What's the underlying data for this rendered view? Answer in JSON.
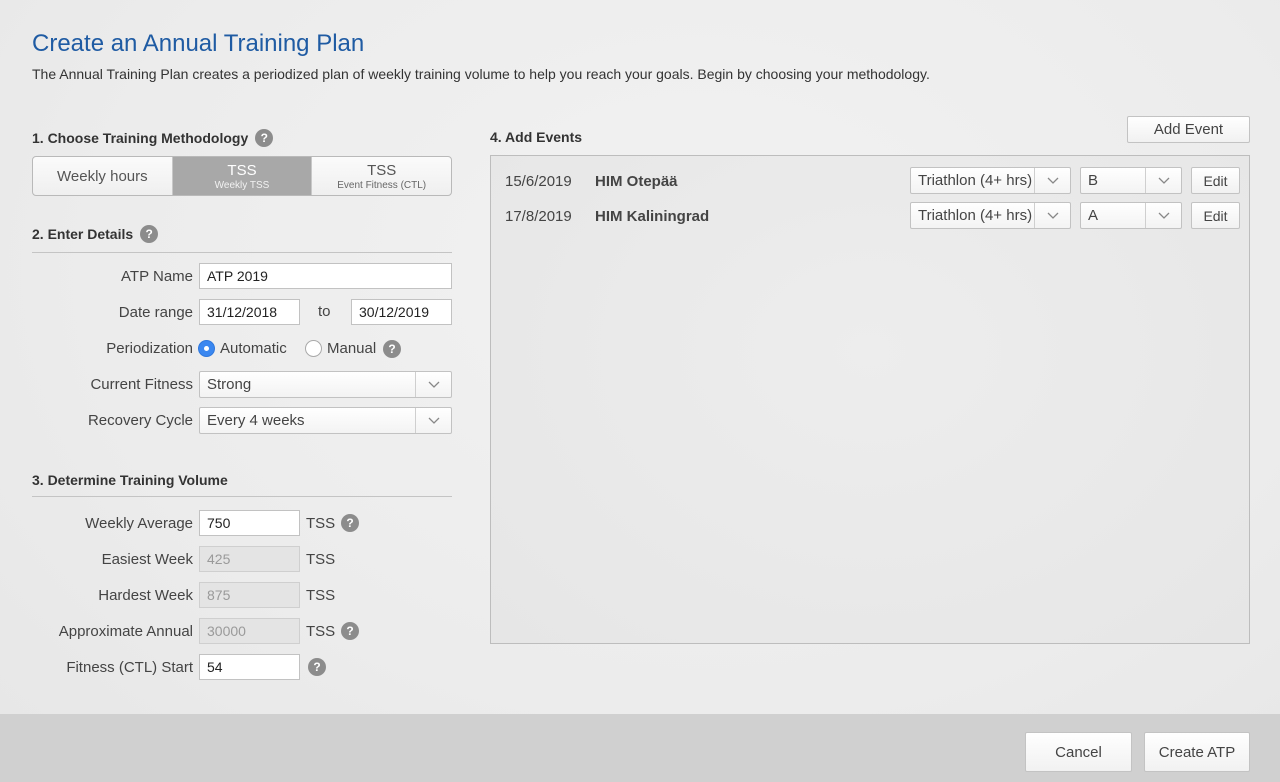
{
  "header": {
    "title": "Create an Annual Training Plan",
    "subtitle": "The Annual Training Plan creates a periodized plan of weekly training volume to help you reach your goals. Begin by choosing your methodology."
  },
  "methodology": {
    "title": "1. Choose Training Methodology",
    "help": "?",
    "options": [
      {
        "label": "Weekly hours",
        "sub": ""
      },
      {
        "label": "TSS",
        "sub": "Weekly TSS",
        "selected": true
      },
      {
        "label": "TSS",
        "sub": "Event Fitness (CTL)"
      }
    ]
  },
  "details": {
    "title": "2. Enter Details",
    "help": "?",
    "atp_name_label": "ATP Name",
    "atp_name_value": "ATP 2019",
    "date_range_label": "Date range",
    "date_from": "31/12/2018",
    "date_to_label": "to",
    "date_to": "30/12/2019",
    "periodization_label": "Periodization",
    "periodization_auto": "Automatic",
    "periodization_manual": "Manual",
    "periodization_selected": "Automatic",
    "fitness_label": "Current Fitness",
    "fitness_value": "Strong",
    "recovery_label": "Recovery Cycle",
    "recovery_value": "Every 4 weeks"
  },
  "volume": {
    "title": "3. Determine Training Volume",
    "weekly_label": "Weekly Average",
    "weekly_value": "750",
    "easiest_label": "Easiest Week",
    "easiest_value": "425",
    "hardest_label": "Hardest Week",
    "hardest_value": "875",
    "annual_label": "Approximate Annual",
    "annual_value": "30000",
    "ctl_label": "Fitness (CTL) Start",
    "ctl_value": "54",
    "unit": "TSS",
    "help": "?"
  },
  "events": {
    "title": "4. Add Events",
    "add_button": "Add Event",
    "edit_label": "Edit",
    "items": [
      {
        "date": "15/6/2019",
        "name": "HIM Otepää",
        "type": "Triathlon (4+ hrs)",
        "priority": "B"
      },
      {
        "date": "17/8/2019",
        "name": "HIM Kaliningrad",
        "type": "Triathlon (4+ hrs)",
        "priority": "A"
      }
    ]
  },
  "footer": {
    "cancel": "Cancel",
    "create": "Create ATP"
  },
  "icons": {
    "caret": "chevron-down-icon",
    "help": "question-icon"
  },
  "colors": {
    "title": "#1f5ba3",
    "radio_selected": "#3a87f0",
    "segment_active": "#a8a8a8"
  }
}
